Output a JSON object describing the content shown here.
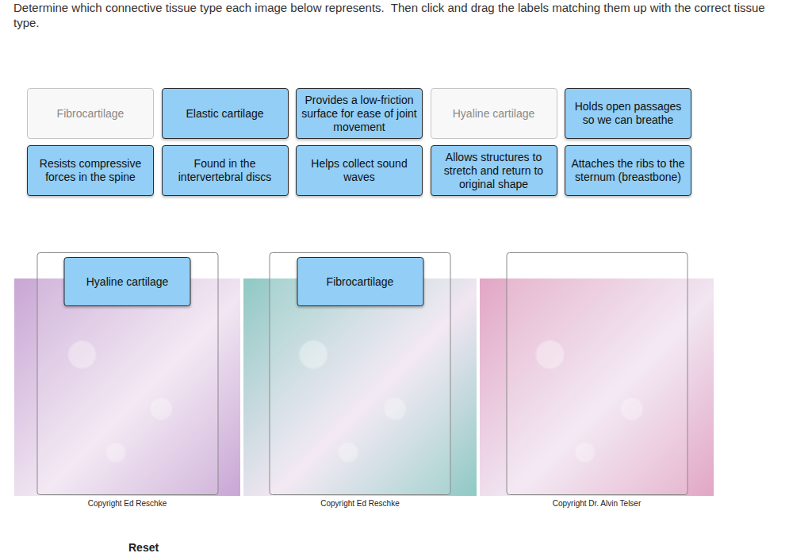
{
  "instructions": "Determine which connective tissue type each image below represents.  Then click and drag the labels matching them up with the correct tissue type.",
  "labels": [
    {
      "text": "Fibrocartilage",
      "placed": true
    },
    {
      "text": "Elastic cartilage",
      "placed": false
    },
    {
      "text": "Provides a low-friction surface for ease of joint movement",
      "placed": false
    },
    {
      "text": "Hyaline cartilage",
      "placed": true
    },
    {
      "text": "Holds open passages so we can breathe",
      "placed": false
    },
    {
      "text": "Resists compressive forces in the spine",
      "placed": false
    },
    {
      "text": "Found in the intervertebral discs",
      "placed": false
    },
    {
      "text": "Helps collect sound waves",
      "placed": false
    },
    {
      "text": "Allows structures to stretch and return to original shape",
      "placed": false
    },
    {
      "text": "Attaches the ribs to the sternum (breastbone)",
      "placed": false
    }
  ],
  "figures": [
    {
      "placed_label": "Hyaline cartilage",
      "caption": "Copyright Ed Reschke",
      "color": "#c8a6d4"
    },
    {
      "placed_label": "Fibrocartilage",
      "caption": "Copyright Ed Reschke",
      "color": "#8fc9c4"
    },
    {
      "placed_label": null,
      "caption": "Copyright Dr. Alvin Telser",
      "color": "#e2a6c4"
    }
  ],
  "reset": "Reset"
}
